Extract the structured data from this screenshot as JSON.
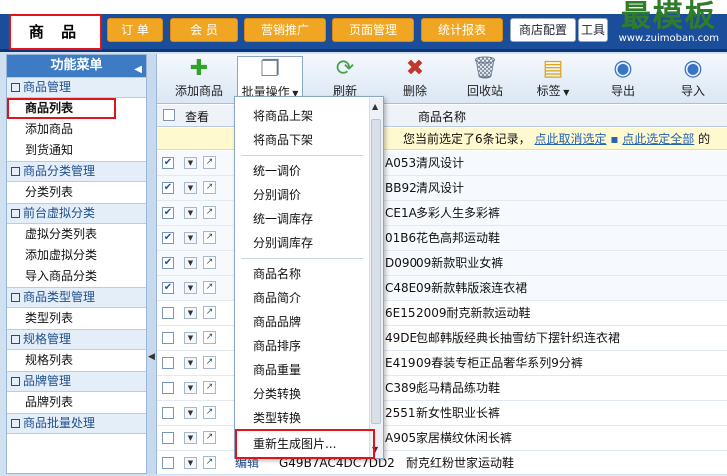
{
  "header": {
    "tabs": [
      {
        "label": "商 品"
      },
      {
        "label": "订 单"
      },
      {
        "label": "会 员"
      },
      {
        "label": "营销推广"
      },
      {
        "label": "页面管理"
      },
      {
        "label": "统计报表"
      },
      {
        "label": "商店配置"
      },
      {
        "label": "工具"
      }
    ],
    "logo_text": "最模板",
    "logo_url": "www.zuimoban.com"
  },
  "sidebar": {
    "title": "功能菜单",
    "groups": [
      {
        "label": "商品管理",
        "items": [
          "商品列表",
          "添加商品",
          "到货通知"
        ]
      },
      {
        "label": "商品分类管理",
        "items": [
          "分类列表"
        ]
      },
      {
        "label": "前台虚拟分类",
        "items": [
          "虚拟分类列表",
          "添加虚拟分类",
          "导入商品分类"
        ]
      },
      {
        "label": "商品类型管理",
        "items": [
          "类型列表"
        ]
      },
      {
        "label": "规格管理",
        "items": [
          "规格列表"
        ]
      },
      {
        "label": "品牌管理",
        "items": [
          "品牌列表"
        ]
      },
      {
        "label": "商品批量处理",
        "items": []
      }
    ],
    "selected_item": "商品列表"
  },
  "toolbar": {
    "add": "添加商品",
    "batch": "批量操作",
    "refresh": "刷新",
    "delete": "删除",
    "recycle": "回收站",
    "tag": "标签",
    "export": "导出",
    "import": "导入"
  },
  "table": {
    "col_view": "查看",
    "col_name": "商品名称",
    "selection_text": "您当前选定了6条记录，",
    "cancel_link": "点此取消选定",
    "select_all_link": "点此选定全部",
    "trailing": "的"
  },
  "rows": [
    {
      "checked": true,
      "code": "A053",
      "name": "清风设计"
    },
    {
      "checked": true,
      "code": "BB92",
      "name": "清风设计"
    },
    {
      "checked": true,
      "code": "CE1A",
      "name": "多彩人生多彩裤"
    },
    {
      "checked": true,
      "code": "01B6",
      "name": "花色高邦运动鞋"
    },
    {
      "checked": true,
      "code": "D090",
      "name": "09新款职业女裤"
    },
    {
      "checked": true,
      "code": "C48E",
      "name": "09新款韩版滚连衣裙"
    },
    {
      "checked": false,
      "code": "6E15",
      "name": "2009耐克新款运动鞋"
    },
    {
      "checked": false,
      "code": "49DE",
      "name": "包邮韩版经典长抽雪纺下摆针织连衣裙"
    },
    {
      "checked": false,
      "code": "E419",
      "name": "09春装专柜正品奢华系列9分裤"
    },
    {
      "checked": false,
      "code": "C389",
      "name": "彪马精品练功鞋"
    },
    {
      "checked": false,
      "code": "2551",
      "name": "新女性职业长裤"
    },
    {
      "checked": false,
      "code": "A905",
      "name": "家居横纹休闲长裤"
    },
    {
      "checked": false,
      "edit": "编辑",
      "code": "G49B7AC4DC7DD2",
      "name": "耐克红粉世家运动鞋"
    }
  ],
  "batch_menu": {
    "items": [
      "将商品上架",
      "将商品下架",
      "统一调价",
      "分别调价",
      "统一调库存",
      "分别调库存",
      "商品名称",
      "商品简介",
      "商品品牌",
      "商品排序",
      "商品重量",
      "分类转换",
      "类型转换",
      "重新生成图片..."
    ]
  },
  "colors": {
    "accent_blue": "#1a4d9a",
    "tab_orange": "#f0a623",
    "highlight_red": "#e0141b"
  }
}
